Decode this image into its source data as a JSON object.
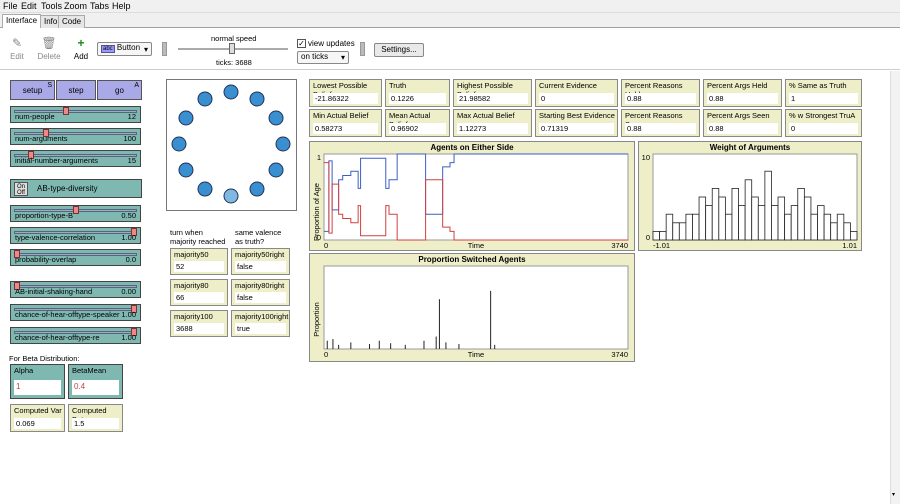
{
  "menubar": {
    "file": "File",
    "edit": "Edit",
    "tools": "Tools",
    "zoom": "Zoom",
    "tabs": "Tabs",
    "help": "Help"
  },
  "tabs": {
    "interface": "Interface",
    "info": "Info",
    "code": "Code"
  },
  "toolbar": {
    "edit_label": "Edit",
    "delete_label": "Delete",
    "add_label": "Add",
    "widget_type": "Button",
    "speed_label": "normal speed",
    "ticks_label": "ticks: 3688",
    "view_updates_label": "view updates",
    "update_mode": "on ticks",
    "settings_label": "Settings..."
  },
  "buttons": {
    "setup": "setup",
    "setup_key": "S",
    "step": "step",
    "go": "go",
    "go_key": "A"
  },
  "sliders": [
    {
      "name": "num-people",
      "value": "12",
      "fraction": 0.42
    },
    {
      "name": "num-arguments",
      "value": "100",
      "fraction": 0.25
    },
    {
      "name": "initial-number-arguments",
      "value": "15",
      "fraction": 0.12
    },
    {
      "name": "proportion-type-B",
      "value": "0.50",
      "fraction": 0.5
    },
    {
      "name": "type-valence-correlation",
      "value": "1.00",
      "fraction": 1.0
    },
    {
      "name": "probability-overlap",
      "value": "0.0",
      "fraction": 0.0
    },
    {
      "name": "AB-initial-shaking-hand",
      "value": "0.00",
      "fraction": 0.0
    },
    {
      "name": "chance-of-hear-offtype-speaker",
      "value": "1.00",
      "fraction": 1.0
    },
    {
      "name": "chance-of-hear-offtype-re",
      "value": "1.00",
      "fraction": 1.0
    }
  ],
  "switch": {
    "on": "On",
    "off": "Off",
    "name": "AB-type-diversity"
  },
  "beta": {
    "heading": "For Beta Distribution:",
    "alpha_label": "Alpha",
    "alpha_value": "1",
    "betamean_label": "BetaMean",
    "betamean_value": "0.4",
    "computed_var_label": "Computed Var",
    "computed_var_value": "0.069",
    "computed_beta_label": "Computed Beta",
    "computed_beta_value": "1.5"
  },
  "majority": {
    "col1_heading": "turn when majority reached",
    "col2_heading": "same valence as truth?",
    "items": [
      {
        "name": "majority50",
        "value": "52",
        "rname": "majority50right",
        "rvalue": "false"
      },
      {
        "name": "majority80",
        "value": "66",
        "rname": "majority80right",
        "rvalue": "false"
      },
      {
        "name": "majority100",
        "value": "3688",
        "rname": "majority100right",
        "rvalue": "true"
      }
    ]
  },
  "monitors_row1": [
    {
      "name": "Lowest Possible Belief",
      "value": "-21.86322"
    },
    {
      "name": "Truth",
      "value": "0.1226"
    },
    {
      "name": "Highest Possible Belief",
      "value": "21.98582"
    },
    {
      "name": "Current Evidence",
      "value": "0"
    },
    {
      "name": "Percent Reasons Held",
      "value": "0.88"
    },
    {
      "name": "Percent Args Held",
      "value": "0.88"
    },
    {
      "name": "% Same as Truth",
      "value": "1"
    }
  ],
  "monitors_row2": [
    {
      "name": "Min Actual Belief",
      "value": "0.58273"
    },
    {
      "name": "Mean Actual Belief",
      "value": "0.96902"
    },
    {
      "name": "Max Actual Belief",
      "value": "1.12273"
    },
    {
      "name": "Starting Best Evidence",
      "value": "0.71319"
    },
    {
      "name": "Percent Reasons Seen",
      "value": "0.88"
    },
    {
      "name": "Percent Args Seen",
      "value": "0.88"
    },
    {
      "name": "% w Strongest TruA",
      "value": "0"
    }
  ],
  "chart_data": [
    {
      "type": "line",
      "title": "Agents on Either Side",
      "xlabel": "Time",
      "ylabel": "Proportion of Age",
      "xlim": [
        0,
        3740
      ],
      "ylim": [
        0,
        1
      ],
      "x_tick_labels": [
        "0",
        "3740"
      ],
      "y_tick_labels": [
        "0",
        "1"
      ],
      "series": [
        {
          "color": "#3b5fc4",
          "x": [
            0,
            50,
            60,
            100,
            180,
            230,
            330,
            420,
            450,
            700,
            760,
            800,
            900,
            1180,
            1250,
            1420,
            1460,
            1550,
            1600,
            3740
          ],
          "y": [
            0.1,
            0.1,
            0.92,
            0.35,
            0.7,
            0.75,
            0.8,
            0.6,
            0.95,
            0.95,
            0.6,
            0.7,
            1.0,
            1.0,
            0.3,
            0.3,
            0.85,
            0.9,
            1.0,
            1.0
          ]
        },
        {
          "color": "#d04040",
          "x": [
            0,
            50,
            60,
            100,
            180,
            230,
            330,
            420,
            450,
            700,
            760,
            800,
            900,
            1180,
            1250,
            1420,
            1460,
            1550,
            1600,
            3740
          ],
          "y": [
            0.9,
            0.9,
            0.08,
            0.65,
            0.3,
            0.25,
            0.2,
            0.4,
            0.05,
            0.05,
            0.4,
            0.3,
            0.0,
            0.0,
            0.7,
            0.7,
            0.15,
            0.1,
            0.0,
            0.0
          ]
        }
      ]
    },
    {
      "type": "bar",
      "title": "Weight of Arguments",
      "xlim": [
        -1.01,
        1.01
      ],
      "ylim": [
        0,
        10
      ],
      "x_tick_labels": [
        "-1.01",
        "1.01"
      ],
      "y_tick_labels": [
        "0",
        "10"
      ],
      "values": [
        1,
        1,
        3,
        2,
        2,
        3,
        3,
        5,
        4,
        6,
        5,
        3,
        6,
        4,
        7,
        5,
        4,
        8,
        4,
        5,
        3,
        4,
        6,
        5,
        3,
        4,
        3,
        2,
        3,
        2,
        1
      ]
    },
    {
      "type": "bar",
      "title": "Proportion Switched Agents",
      "xlabel": "Time",
      "ylabel": "Proportion",
      "xlim": [
        0,
        3740
      ],
      "x_tick_labels": [
        "0",
        "3740"
      ],
      "spikes": [
        {
          "x": 40,
          "v": 0.1
        },
        {
          "x": 110,
          "v": 0.12
        },
        {
          "x": 180,
          "v": 0.05
        },
        {
          "x": 330,
          "v": 0.08
        },
        {
          "x": 560,
          "v": 0.06
        },
        {
          "x": 680,
          "v": 0.1
        },
        {
          "x": 820,
          "v": 0.07
        },
        {
          "x": 1000,
          "v": 0.05
        },
        {
          "x": 1230,
          "v": 0.1
        },
        {
          "x": 1380,
          "v": 0.15
        },
        {
          "x": 1420,
          "v": 0.6
        },
        {
          "x": 1500,
          "v": 0.08
        },
        {
          "x": 1660,
          "v": 0.06
        },
        {
          "x": 2050,
          "v": 0.7
        },
        {
          "x": 2100,
          "v": 0.05
        }
      ]
    }
  ],
  "agents": {
    "count": 12,
    "color": "#3a8fd0",
    "highlight": "#7fb8e0"
  }
}
